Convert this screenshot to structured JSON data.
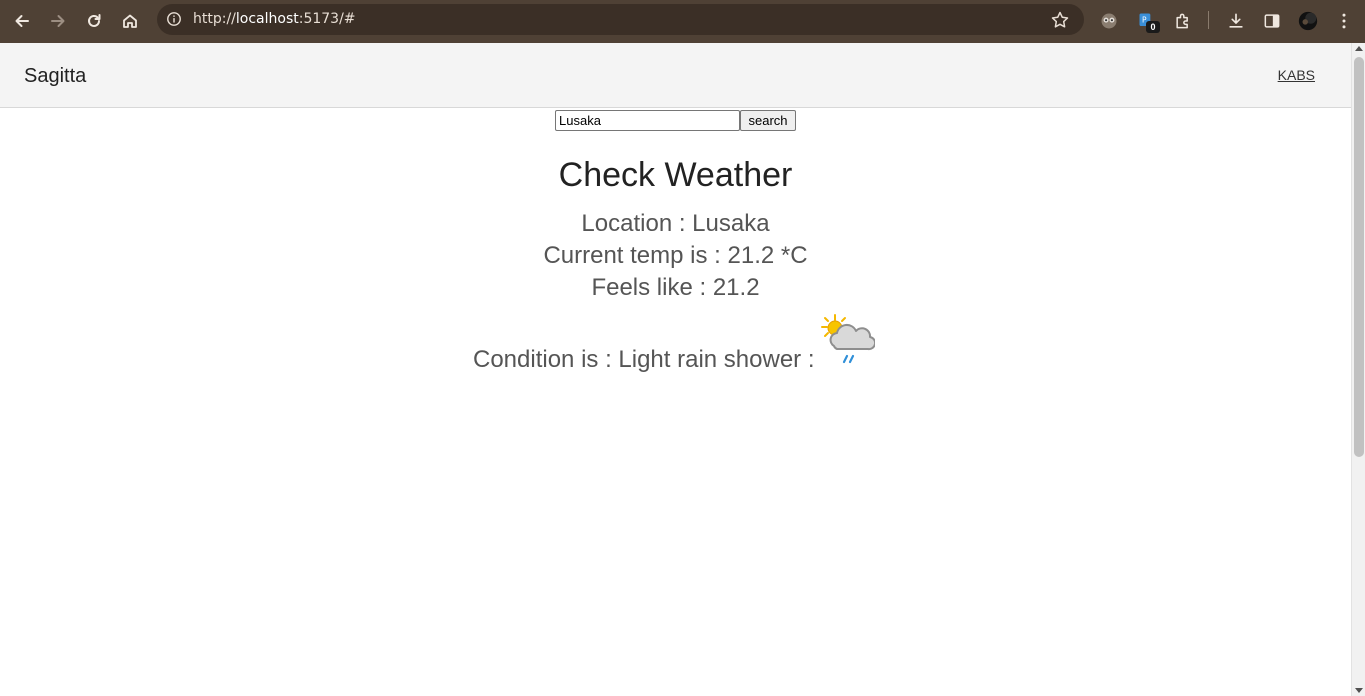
{
  "browser": {
    "url_scheme": "http://",
    "url_host": "localhost",
    "url_rest": ":5173/#",
    "extension_badge": "0"
  },
  "navbar": {
    "brand": "Sagitta",
    "link": "KABS"
  },
  "search": {
    "value": "Lusaka",
    "button_label": "search"
  },
  "weather": {
    "title": "Check Weather",
    "location_line": "Location : Lusaka",
    "temp_line": "Current temp is : 21.2 *C",
    "feels_line": "Feels like : 21.2",
    "condition_line": "Condition is : Light rain shower :",
    "condition_icon": "partly-cloudy-rain-icon"
  },
  "colors": {
    "chrome_bg": "#4f4135",
    "navbar_bg": "#f4f4f4",
    "text_main": "#222222",
    "text_secondary": "#555555"
  }
}
